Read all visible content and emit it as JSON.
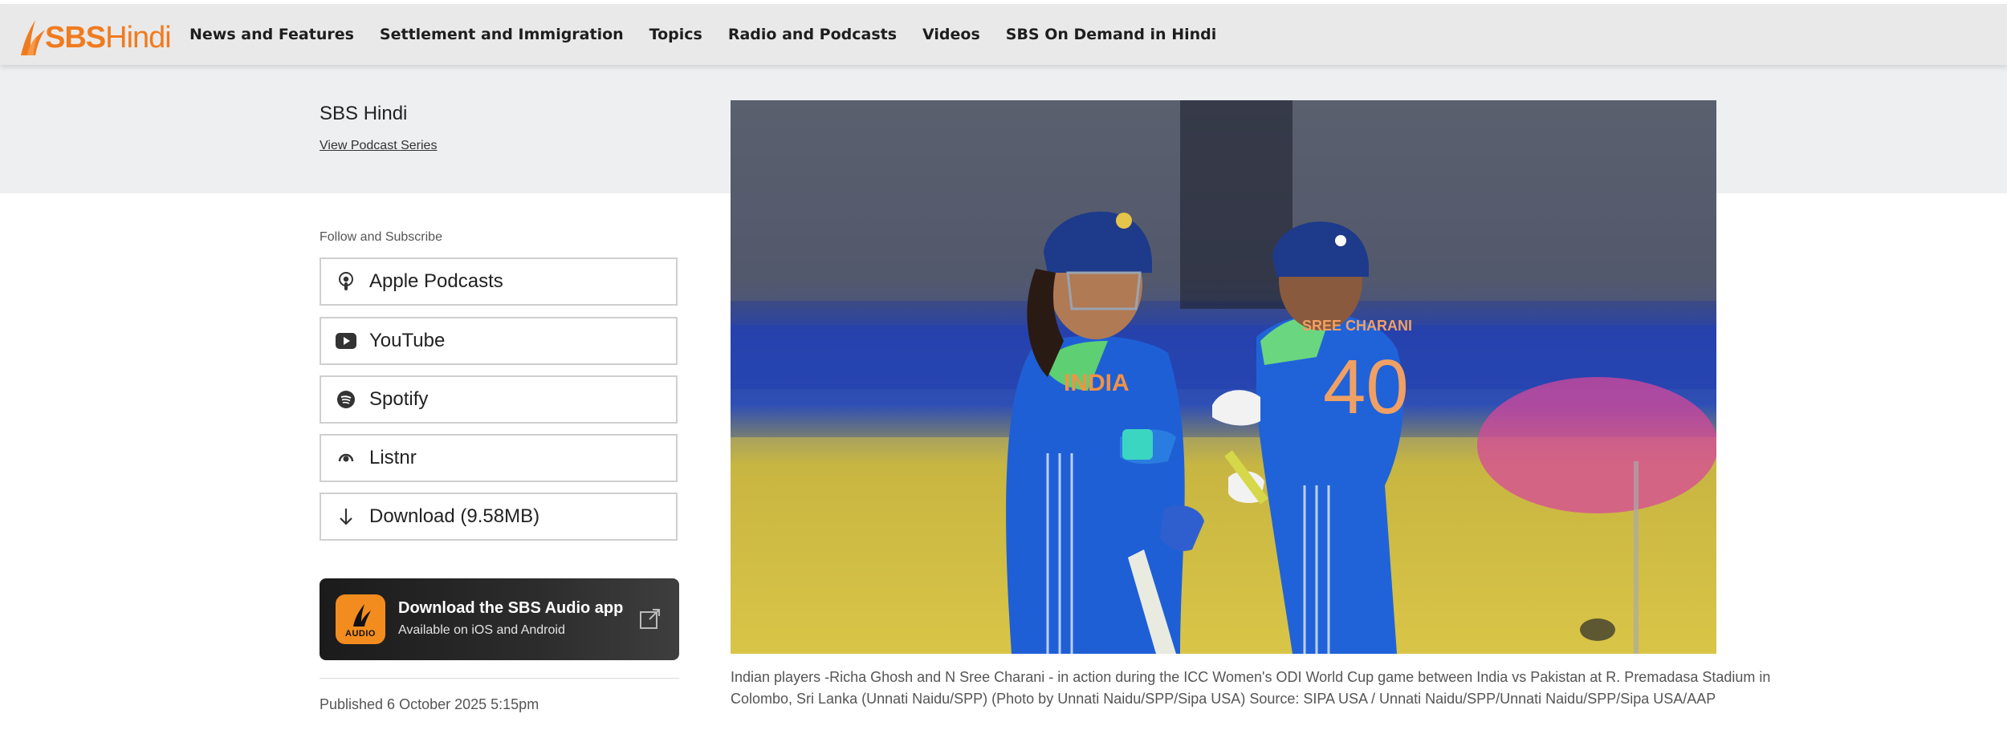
{
  "header": {
    "logo_primary": "SBS",
    "logo_secondary": "Hindi",
    "nav": [
      {
        "label": "News and Features"
      },
      {
        "label": "Settlement and Immigration"
      },
      {
        "label": "Topics"
      },
      {
        "label": "Radio and Podcasts"
      },
      {
        "label": "Videos"
      },
      {
        "label": "SBS On Demand in Hindi"
      }
    ]
  },
  "series": {
    "title": "SBS Hindi",
    "view_link": "View Podcast Series"
  },
  "subscribe": {
    "heading": "Follow and Subscribe",
    "buttons": [
      {
        "label": "Apple Podcasts",
        "icon": "podcast-icon"
      },
      {
        "label": "YouTube",
        "icon": "youtube-icon"
      },
      {
        "label": "Spotify",
        "icon": "spotify-icon"
      },
      {
        "label": "Listnr",
        "icon": "listnr-icon"
      },
      {
        "label": "Download (9.58MB)",
        "icon": "download-icon"
      }
    ]
  },
  "app_promo": {
    "title": "Download the SBS Audio app",
    "subtitle": "Available on iOS and Android",
    "icon_text": "AUDIO"
  },
  "published": "Published 6 October 2025 5:15pm",
  "photo": {
    "jersey_left": "INDIA",
    "jersey_name_right": "SREE CHARANI",
    "jersey_number": "40",
    "caption": "Indian players -Richa Ghosh and N Sree Charani - in action during the ICC Women's ODI World Cup game between India vs Pakistan at R. Premadasa Stadium in Colombo, Sri Lanka (Unnati Naidu/SPP) (Photo by Unnati Naidu/SPP/Sipa USA) Source: SIPA USA / Unnati Naidu/SPP/Unnati Naidu/SPP/Sipa USA/AAP"
  },
  "colors": {
    "brand_orange": "#f07b1f",
    "nav_background": "#e9e9e9",
    "band_background": "#eeeff1",
    "jersey_blue": "#1f5fd6"
  }
}
